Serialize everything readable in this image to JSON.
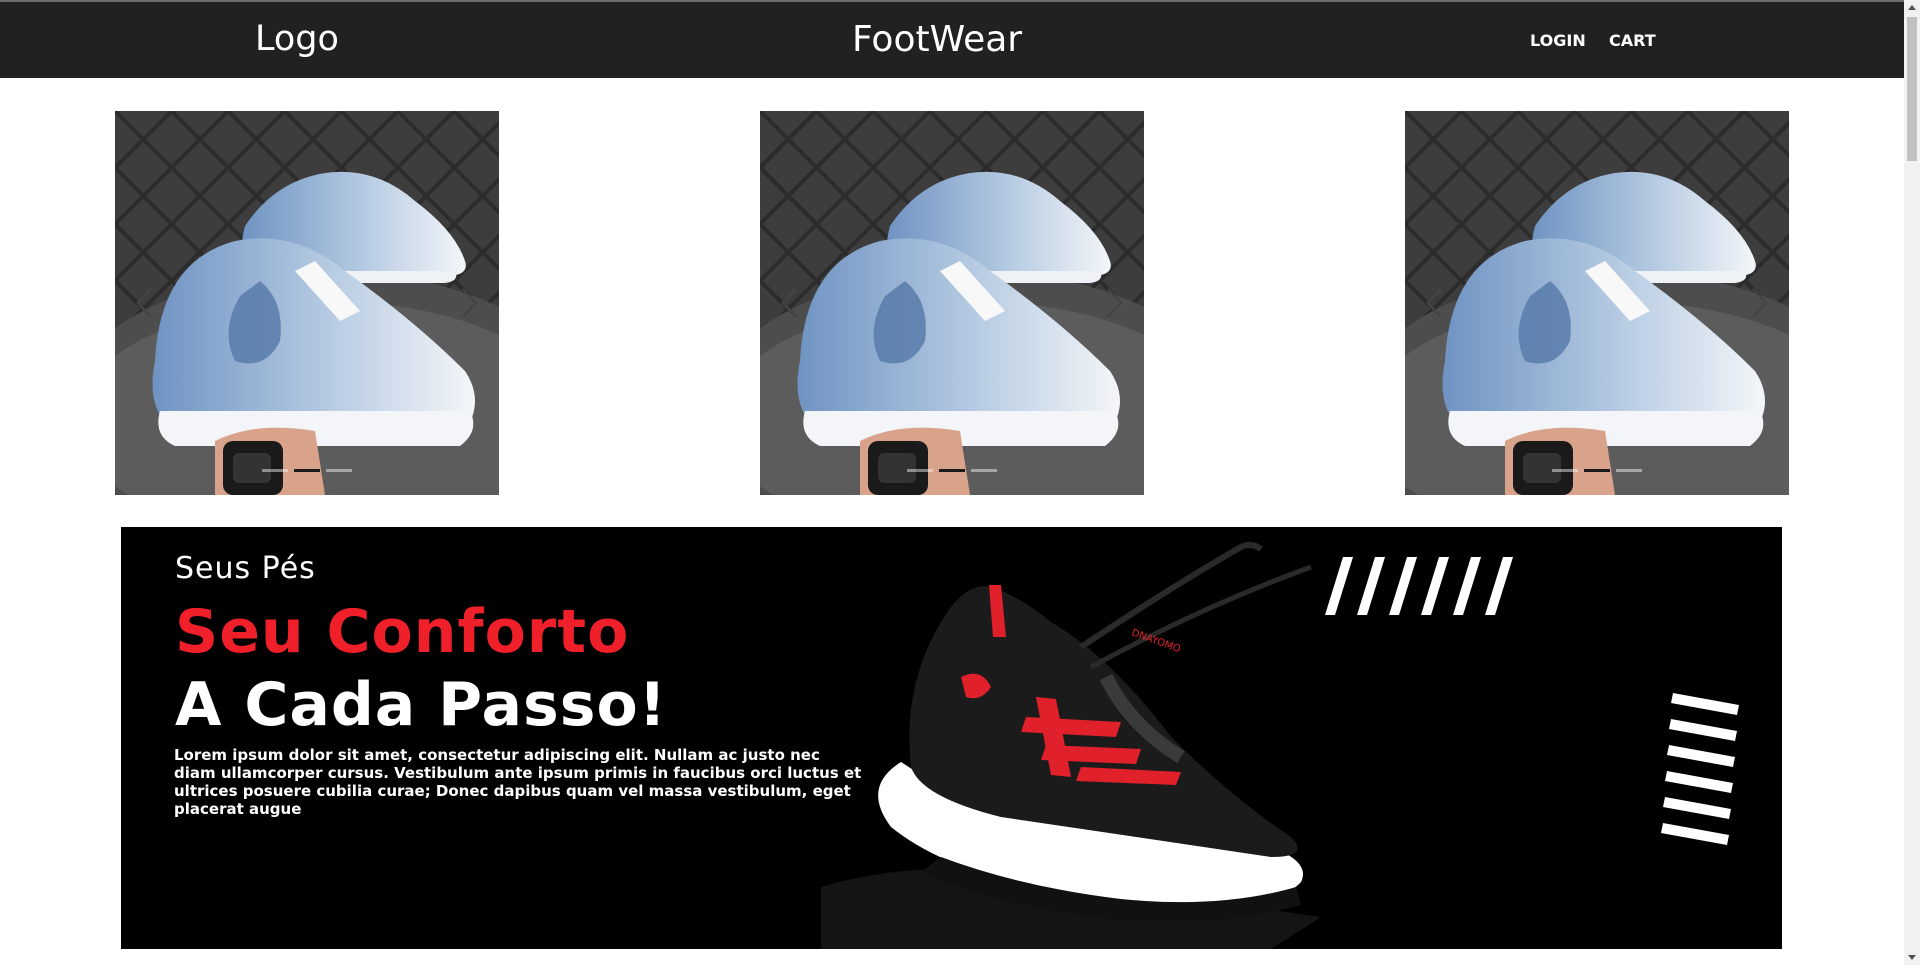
{
  "header": {
    "logo": "Logo",
    "brand": "FootWear",
    "nav": {
      "login": "LOGIN",
      "cart": "CART"
    }
  },
  "carousels": [
    {
      "image": "sneaker-pair-photo",
      "slides": 3,
      "active_slide": 1
    },
    {
      "image": "sneaker-pair-photo",
      "slides": 3,
      "active_slide": 1
    },
    {
      "image": "sneaker-pair-photo",
      "slides": 3,
      "active_slide": 1
    }
  ],
  "banner": {
    "tagline": "Seus Pés",
    "title_line1": "Seu Conforto",
    "title_line2": "A Cada Passo!",
    "body": "Lorem ipsum dolor sit amet, consectetur adipiscing elit. Nullam ac justo nec diam ullamcorper cursus. Vestibulum ante ipsum primis in faucibus orci luctus et ultrices posuere cubilia curae; Donec dapibus quam vel massa vestibulum, eget placerat augue",
    "shoe_logo": "DNAYOMO",
    "colors": {
      "background": "#000000",
      "accent": "#f0202a",
      "text": "#ffffff"
    }
  },
  "colors": {
    "navbar": "#212121",
    "page": "#ffffff"
  }
}
